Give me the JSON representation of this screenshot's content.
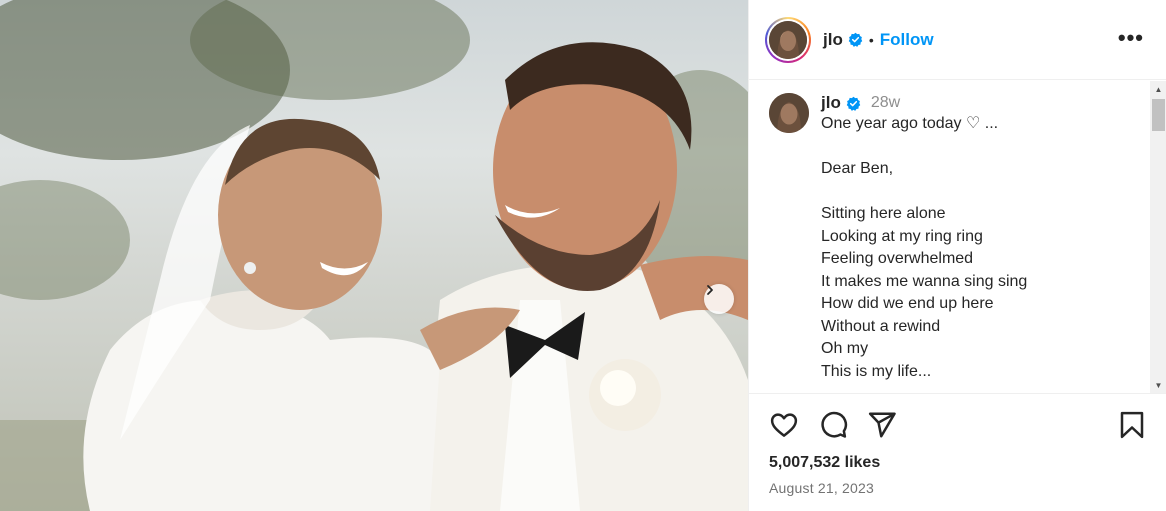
{
  "post": {
    "username": "jlo",
    "separator": "•",
    "follow_label": "Follow",
    "more_label": "•••",
    "caption": {
      "username": "jlo",
      "time_ago": "28w",
      "lines": [
        "One year ago today ♡ ...",
        "",
        "Dear Ben,",
        "",
        "Sitting here alone",
        "Looking at my ring ring",
        "Feeling overwhelmed",
        "It makes me wanna sing sing",
        "How did we end up here",
        "Without a rewind",
        "Oh my",
        "This is my life..."
      ]
    },
    "likes": "5,007,532 likes",
    "date": "August 21, 2023"
  },
  "icons": {
    "verified": "verified-badge-icon",
    "like": "heart-icon",
    "comment": "comment-icon",
    "share": "share-icon",
    "save": "bookmark-icon",
    "next": "chevron-right-icon"
  },
  "colors": {
    "follow": "#0095f6",
    "verified": "#0095f6",
    "text": "#262626",
    "muted": "#737373"
  }
}
